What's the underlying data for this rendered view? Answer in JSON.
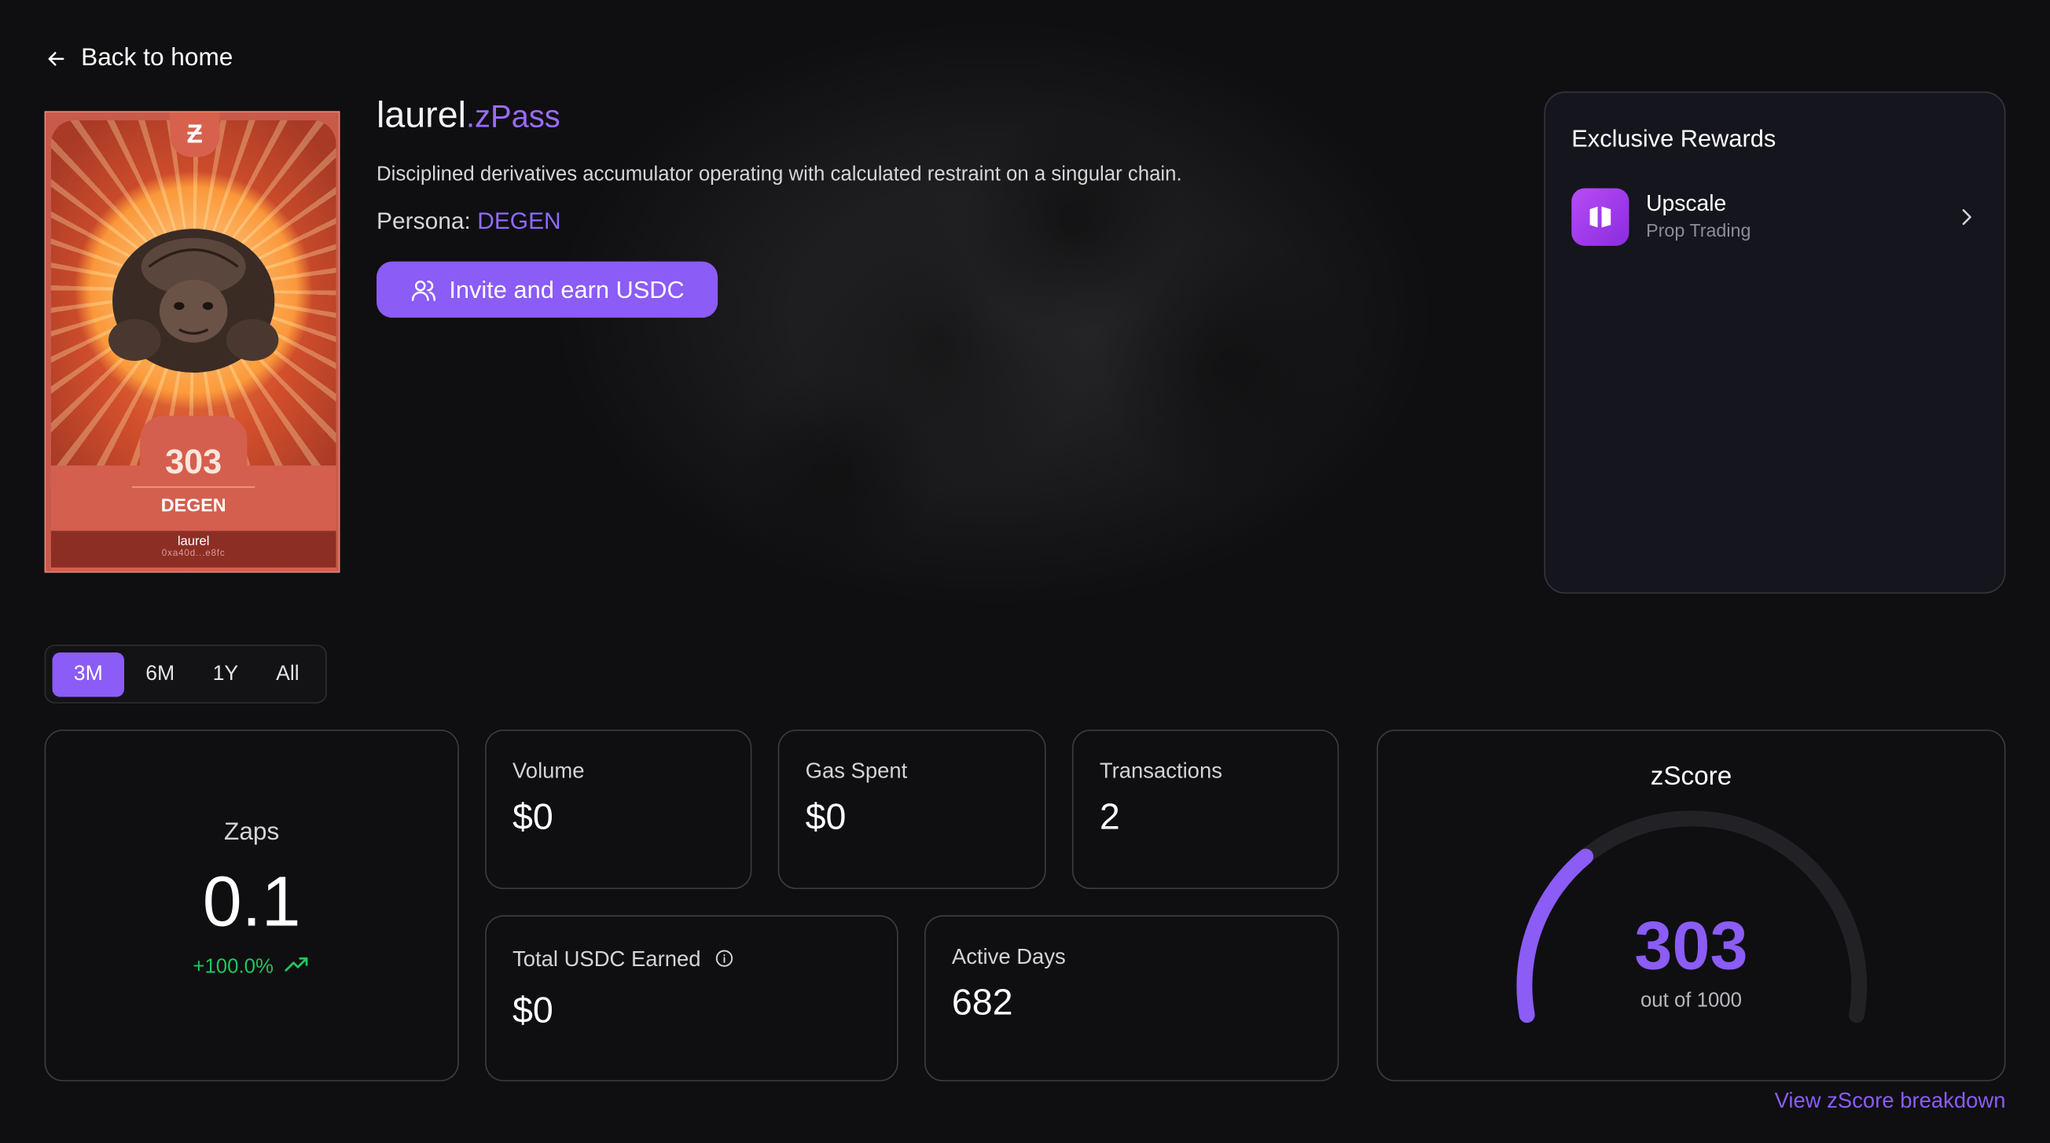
{
  "nav": {
    "back_label": "Back to home"
  },
  "profile": {
    "name": "laurel",
    "suffix": ".zPass",
    "description": "Disciplined derivatives accumulator operating with calculated restraint on a singular chain.",
    "persona_label": "Persona:",
    "persona_value": "DEGEN",
    "invite_label": "Invite and earn USDC"
  },
  "card": {
    "logo": "Ƶ",
    "score": "303",
    "persona": "DEGEN",
    "name": "laurel",
    "address": "0xa40d...e8fc"
  },
  "rewards": {
    "title": "Exclusive Rewards",
    "items": [
      {
        "name": "Upscale",
        "subtitle": "Prop Trading",
        "icon": "upscale-logo"
      }
    ]
  },
  "periods": {
    "options": [
      "3M",
      "6M",
      "1Y",
      "All"
    ],
    "selected": "3M"
  },
  "stats": {
    "zaps": {
      "label": "Zaps",
      "value": "0.1",
      "change": "+100.0%"
    },
    "volume": {
      "label": "Volume",
      "value": "$0"
    },
    "gas": {
      "label": "Gas Spent",
      "value": "$0"
    },
    "transactions": {
      "label": "Transactions",
      "value": "2"
    },
    "usdc": {
      "label": "Total USDC Earned",
      "value": "$0"
    },
    "active_days": {
      "label": "Active Days",
      "value": "682"
    }
  },
  "zscore": {
    "title": "zScore",
    "score": "303",
    "out_of": "out of 1000",
    "score_value": 303,
    "max_value": 1000,
    "link_label": "View zScore breakdown"
  },
  "colors": {
    "accent": "#8b5cf6",
    "positive": "#22c55e",
    "card": "#c85a4c"
  }
}
